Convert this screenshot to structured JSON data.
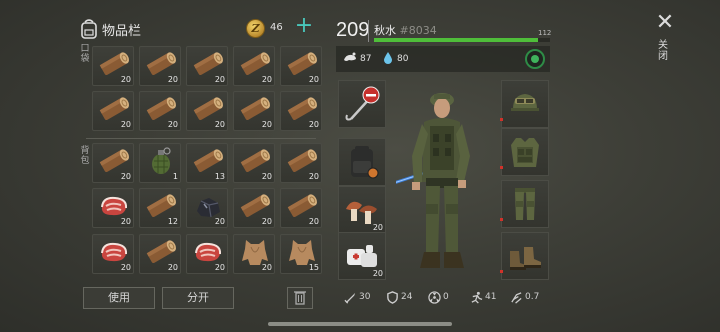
{
  "inventory": {
    "title": "物品栏",
    "coins": "46",
    "add_label": "+",
    "pockets_label": "口袋",
    "backpack_label": "背包",
    "slots": [
      {
        "item": "log",
        "qty": "20"
      },
      {
        "item": "log",
        "qty": "20"
      },
      {
        "item": "log",
        "qty": "20"
      },
      {
        "item": "log",
        "qty": "20"
      },
      {
        "item": "log",
        "qty": "20"
      },
      {
        "item": "log",
        "qty": "20"
      },
      {
        "item": "log",
        "qty": "20"
      },
      {
        "item": "log",
        "qty": "20"
      },
      {
        "item": "log",
        "qty": "20"
      },
      {
        "item": "log",
        "qty": "20"
      },
      {
        "item": "log",
        "qty": "20"
      },
      {
        "item": "grenade",
        "qty": "1"
      },
      {
        "item": "log",
        "qty": "13"
      },
      {
        "item": "log",
        "qty": "20"
      },
      {
        "item": "log",
        "qty": "20"
      },
      {
        "item": "steak",
        "qty": "20"
      },
      {
        "item": "log",
        "qty": "12"
      },
      {
        "item": "ore",
        "qty": "20"
      },
      {
        "item": "log",
        "qty": "20"
      },
      {
        "item": "log",
        "qty": "20"
      },
      {
        "item": "steak",
        "qty": "20"
      },
      {
        "item": "log",
        "qty": "20"
      },
      {
        "item": "steak",
        "qty": "20"
      },
      {
        "item": "hide",
        "qty": "20"
      },
      {
        "item": "hide",
        "qty": "15"
      }
    ],
    "use_label": "使用",
    "split_label": "分开"
  },
  "character": {
    "level": "209",
    "name": "秋水",
    "id": "#8034",
    "xp_value": "112",
    "xp_progress": 0.93,
    "food": "87",
    "water": "80",
    "quick_slots": [
      {
        "item": "stop-sign-hook",
        "qty": ""
      },
      {
        "item": "backpack",
        "qty": ""
      },
      {
        "item": "mushroom",
        "qty": "20"
      },
      {
        "item": "bandage",
        "qty": "20"
      }
    ],
    "gear_slots": [
      "helmet",
      "vest",
      "pants",
      "boots"
    ],
    "stats": [
      {
        "icon": "sword-icon",
        "value": "30"
      },
      {
        "icon": "shield-icon",
        "value": "24"
      },
      {
        "icon": "radiation-icon",
        "value": "0"
      },
      {
        "icon": "run-icon",
        "value": "41"
      },
      {
        "icon": "speed-icon",
        "value": "0.7"
      }
    ]
  },
  "close": {
    "icon": "✕",
    "label": "关闭"
  },
  "colors": {
    "accent": "#49c7bb",
    "xp_bar": "#4fbe3a",
    "alert": "#d0322a"
  }
}
